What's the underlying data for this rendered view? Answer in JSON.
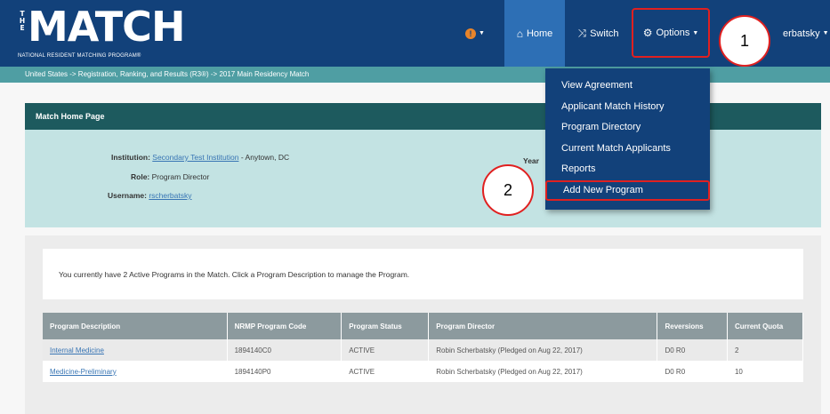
{
  "brand": {
    "the": "THE",
    "match": "MATCH",
    "tagline": "NATIONAL RESIDENT MATCHING PROGRAM®"
  },
  "nav": {
    "alert_icon": "exclamation-circle-icon",
    "alert_glyph": "!",
    "home_label": "Home",
    "switch_label": "Switch",
    "options_label": "Options",
    "user_label": "erbatsky",
    "home_icon": "home-icon",
    "switch_icon": "shuffle-icon",
    "options_icon": "gear-icon"
  },
  "breadcrumb": "United States  ->  Registration, Ranking, and Results (R3®)  ->  2017 Main Residency Match",
  "options_menu": {
    "items": [
      "View Agreement",
      "Applicant Match History",
      "Program Directory",
      "Current Match Applicants",
      "Reports",
      "Add New Program"
    ],
    "highlighted": "Add New Program"
  },
  "home_panel": {
    "title": "Match Home Page",
    "institution_label": "Institution:",
    "institution_value": "Secondary Test Institution",
    "institution_location": " - Anytown, DC",
    "role_label": "Role:",
    "role_value": "Program Director",
    "username_label": "Username:",
    "username_value": "rscherbatsky",
    "year_label": "Year"
  },
  "programs": {
    "note": "You currently have 2 Active Programs in the Match. Click a Program Description to manage the Program.",
    "columns": [
      "Program Description",
      "NRMP Program Code",
      "Program Status",
      "Program Director",
      "Reversions",
      "Current Quota"
    ],
    "rows": [
      [
        "Internal Medicine",
        "1894140C0",
        "ACTIVE",
        "Robin Scherbatsky (Pledged on Aug 22, 2017)",
        "D0 R0",
        "2"
      ],
      [
        "Medicine-Preliminary",
        "1894140P0",
        "ACTIVE",
        "Robin Scherbatsky (Pledged on Aug 22, 2017)",
        "D0 R0",
        "10"
      ]
    ]
  },
  "annotations": [
    "1",
    "2"
  ],
  "colors": {
    "navbar": "#12417a",
    "home_tab": "#2d6fb5",
    "breadcrumb_bar": "#4f9ea3",
    "panel_header": "#1d5a5e",
    "panel_body": "#c3e3e3",
    "highlight_border": "#e02020"
  }
}
